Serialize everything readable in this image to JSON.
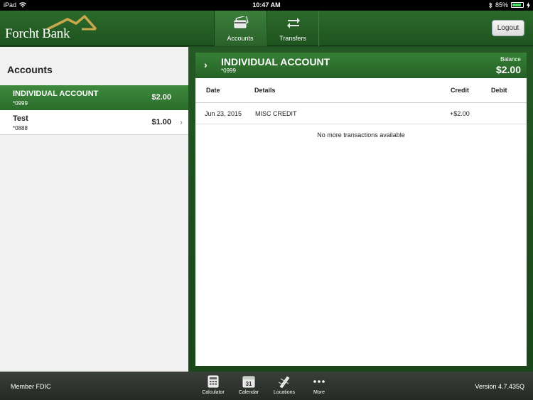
{
  "status_bar": {
    "device": "iPad",
    "time": "10:47 AM",
    "battery": "85%"
  },
  "header": {
    "logo_text": "Forcht Bank",
    "tabs": [
      {
        "label": "Accounts",
        "icon": "cards-icon"
      },
      {
        "label": "Transfers",
        "icon": "transfer-arrows-icon"
      }
    ],
    "logout_label": "Logout"
  },
  "accounts_panel": {
    "title": "Accounts",
    "items": [
      {
        "name": "INDIVIDUAL ACCOUNT",
        "number": "*0999",
        "amount": "$2.00"
      },
      {
        "name": "Test",
        "number": "*0888",
        "amount": "$1.00"
      }
    ]
  },
  "account_detail": {
    "name": "INDIVIDUAL ACCOUNT",
    "number": "*0999",
    "balance_label": "Balance",
    "balance": "$2.00",
    "columns": [
      "Date",
      "Details",
      "Credit",
      "Debit"
    ],
    "transactions": [
      {
        "date": "Jun 23, 2015",
        "details": "MISC CREDIT",
        "credit": "+$2.00",
        "debit": ""
      }
    ],
    "end_message": "No more transactions available"
  },
  "footer": {
    "member": "Member FDIC",
    "version": "Version 4.7.435Q",
    "items": [
      {
        "label": "Calculator"
      },
      {
        "label": "Calendar",
        "day": "31"
      },
      {
        "label": "Locations"
      },
      {
        "label": "More"
      }
    ]
  },
  "colors": {
    "primary_green": "#2b6c2b",
    "dark_green": "#1f4a1f",
    "logo_gold": "#c8a84a"
  }
}
